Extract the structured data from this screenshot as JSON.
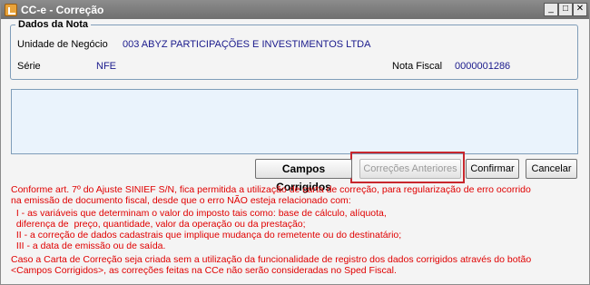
{
  "window": {
    "title": "CC-e - Correção",
    "controls": {
      "minimize": "_",
      "maximize": "□",
      "close": "✕"
    }
  },
  "group": {
    "title": "Dados da Nota",
    "unidade_label": "Unidade de Negócio",
    "unidade_value": "003 ABYZ PARTICIPAÇÕES E INVESTIMENTOS LTDA",
    "serie_label": "Série",
    "serie_value": "NFE",
    "nota_label": "Nota Fiscal",
    "nota_value": "0000001286"
  },
  "memo": {
    "value": ""
  },
  "buttons": {
    "campos_corrigidos": "Campos Corrigidos",
    "correcoes_anteriores": "Correções Anteriores",
    "confirmar": "Confirmar",
    "cancelar": "Cancelar"
  },
  "notice": {
    "line1": "Conforme art. 7º do Ajuste SINIEF S/N, fica permitida a utilização de carta de correção, para regularização de erro ocorrido",
    "line2": "na emissão de documento fiscal, desde que o erro NÃO esteja relacionado com:",
    "line3": "  I - as variáveis que determinam o valor do imposto tais como: base de cálculo, alíquota,",
    "line4": "  diferença de  preço, quantidade, valor da operação ou da prestação;",
    "line5": "  II - a correção de dados cadastrais que implique mudança do remetente ou do destinatário;",
    "line6": "  III - a data de emissão ou de saída.",
    "line7": "Caso a Carta de Correção seja criada sem a utilização da funcionalidade de registro dos dados corrigidos através do botão",
    "line8": "<Campos Corrigidos>, as correções feitas na CCe não serão consideradas no Sped Fiscal."
  },
  "colors": {
    "notice": "#e00000",
    "value_text": "#1a1a8c",
    "highlight": "#c8272d",
    "memo_bg": "#eaf3fc"
  }
}
